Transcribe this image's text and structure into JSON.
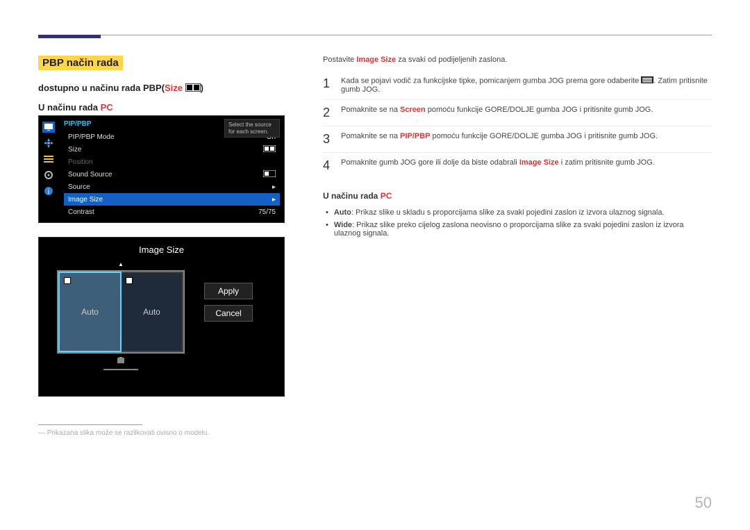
{
  "page_number": "50",
  "section_title": "PBP način rada",
  "subtitle_line": {
    "prefix": "dostupno u načinu rada PBP(",
    "size_word": "Size",
    "suffix": ")"
  },
  "mode_heading_left": {
    "prefix": "U načinu rada ",
    "pc": "PC"
  },
  "osd1": {
    "header": "PIP/PBP",
    "tooltip_line1": "Select the source",
    "tooltip_line2": "for each screen.",
    "rows": [
      {
        "label": "PIP/PBP Mode",
        "value": "On",
        "dim": false,
        "sel": false
      },
      {
        "label": "Size",
        "value": "icon",
        "dim": false,
        "sel": false
      },
      {
        "label": "Position",
        "value": "",
        "dim": true,
        "sel": false
      },
      {
        "label": "Sound Source",
        "value": "icon2",
        "dim": false,
        "sel": false
      },
      {
        "label": "Source",
        "value": "▸",
        "dim": false,
        "sel": false
      },
      {
        "label": "Image Size",
        "value": "▸",
        "dim": false,
        "sel": true
      },
      {
        "label": "Contrast",
        "value": "75/75",
        "dim": false,
        "sel": false
      }
    ]
  },
  "osd2": {
    "title": "Image Size",
    "left_label": "Auto",
    "right_label": "Auto",
    "apply": "Apply",
    "cancel": "Cancel"
  },
  "footnote": "Prikazana slika može se razlikovati ovisno o modelu.",
  "intro": {
    "pre": "Postavite ",
    "red": "Image Size",
    "post": " za svaki od podijeljenih zaslona."
  },
  "steps": [
    {
      "n": "1",
      "parts": [
        "Kada se pojavi vodič za funkcijske tipke, pomicanjem gumba JOG prema gore odaberite ",
        "ICON",
        ". Zatim pritisnite gumb JOG."
      ]
    },
    {
      "n": "2",
      "parts": [
        "Pomaknite se na ",
        {
          "red": "Screen"
        },
        " pomoću funkcije GORE/DOLJE gumba JOG i pritisnite gumb JOG."
      ]
    },
    {
      "n": "3",
      "parts": [
        "Pomaknite se na ",
        {
          "red": "PIP/PBP"
        },
        " pomoću funkcije GORE/DOLJE gumba JOG i pritisnite gumb JOG."
      ]
    },
    {
      "n": "4",
      "parts": [
        "Pomaknite gumb JOG gore ili dolje da biste odabrali ",
        {
          "red": "Image Size"
        },
        " i zatim pritisnite gumb JOG."
      ]
    }
  ],
  "mode_heading_right": {
    "prefix": "U načinu rada ",
    "pc": "PC"
  },
  "bullets": [
    {
      "bold": "Auto",
      "text": ": Prikaz slike u skladu s proporcijama slike za svaki pojedini zaslon iz izvora ulaznog signala."
    },
    {
      "bold": "Wide",
      "text": ": Prikaz slike preko cijelog zaslona neovisno o proporcijama slike za svaki pojedini zaslon iz izvora ulaznog signala."
    }
  ]
}
